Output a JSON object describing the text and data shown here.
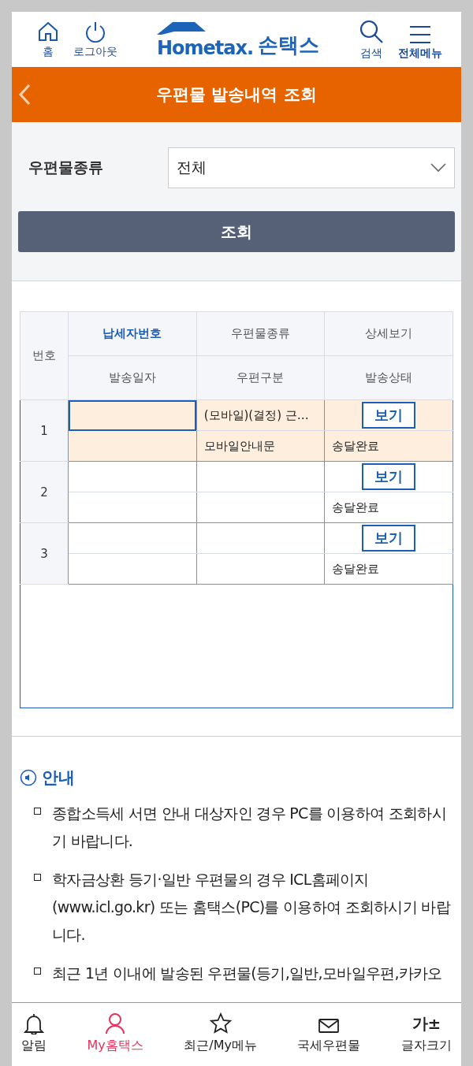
{
  "header": {
    "left_buttons": [
      {
        "kind": "home",
        "label": "홈"
      },
      {
        "kind": "power",
        "label": "로그아웃"
      }
    ],
    "logo": {
      "brand": "Hometax.",
      "app_name": "손택스"
    },
    "right_buttons": [
      {
        "kind": "search",
        "label": "검색"
      },
      {
        "kind": "menu",
        "label": "전체메뉴"
      }
    ]
  },
  "title_bar": {
    "title": "우편물 발송내역 조회"
  },
  "filter": {
    "label": "우편물종류",
    "value": "전체",
    "search_button": "조회"
  },
  "table": {
    "columns": {
      "number": "번호",
      "taxpayer_no": "납세자번호",
      "mail_type": "우편물종류",
      "detail": "상세보기",
      "send_date": "발송일자",
      "mail_class": "우편구분",
      "send_status": "발송상태"
    },
    "rows": [
      {
        "number": "1",
        "selected": true,
        "mail_type": "(모바일)(결정) 근…",
        "view_button": "보기",
        "mail_class": "모바일안내문",
        "send_status": "송달완료"
      },
      {
        "number": "2",
        "selected": false,
        "view_button": "보기",
        "send_status": "송달완료"
      },
      {
        "number": "3",
        "selected": false,
        "view_button": "보기",
        "send_status": "송달완료"
      }
    ]
  },
  "notice": {
    "title": "안내",
    "items": [
      "종합소득세 서면 안내 대상자인 경우 PC를 이용하여 조회하시기 바랍니다.",
      "학자금상환 등기·일반 우편물의 경우 ICL홈페이지 (www.icl.go.kr) 또는 홈택스(PC)를 이용하여 조회하시기 바랍니다.",
      "최근 1년 이내에 발송된 우편물(등기,일반,모바일우편,카카오"
    ]
  },
  "bottom_nav": [
    {
      "kind": "bell",
      "label": "알림",
      "selected": false
    },
    {
      "kind": "person",
      "label": "My홈택스",
      "selected": true
    },
    {
      "kind": "star",
      "label": "최근/My메뉴",
      "selected": false
    },
    {
      "kind": "mail",
      "label": "국세우편물",
      "selected": false
    },
    {
      "kind": "fontsize",
      "label": "글자크기",
      "glyph": "가±",
      "selected": false
    }
  ]
}
